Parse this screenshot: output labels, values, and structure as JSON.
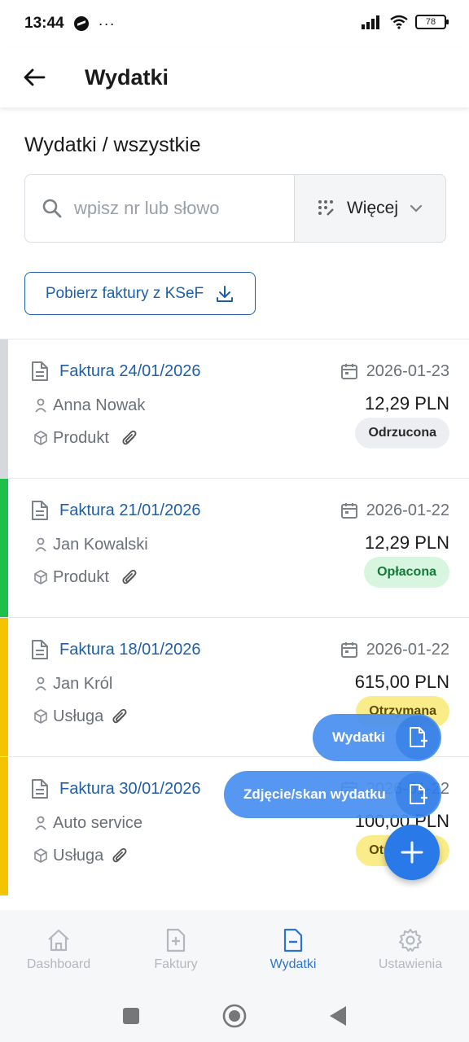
{
  "status_bar": {
    "time": "13:44",
    "battery": "78"
  },
  "header": {
    "title": "Wydatki"
  },
  "page": {
    "section_title": "Wydatki / wszystkie"
  },
  "search": {
    "placeholder": "wpisz nr lub słowo",
    "more_label": "Więcej"
  },
  "ksef_button": {
    "label": "Pobierz faktury z KSeF"
  },
  "invoices": [
    {
      "number": "Faktura 24/01/2026",
      "person": "Anna Nowak",
      "category": "Produkt",
      "date": "2026-01-23",
      "amount": "12,29 PLN",
      "status": "Odrzucona",
      "bar_color": "#d5d8dd"
    },
    {
      "number": "Faktura 21/01/2026",
      "person": "Jan Kowalski",
      "category": "Produkt",
      "date": "2026-01-22",
      "amount": "12,29 PLN",
      "status": "Opłacona",
      "bar_color": "#1fbf4c"
    },
    {
      "number": "Faktura 18/01/2026",
      "person": "Jan Król",
      "category": "Usługa",
      "date": "2026-01-22",
      "amount": "615,00 PLN",
      "status": "Otrzymana",
      "bar_color": "#f5c400"
    },
    {
      "number": "Faktura 30/01/2026",
      "person": "Auto service",
      "category": "Usługa",
      "date": "2026-01-22",
      "amount": "100,00 PLN",
      "status": "Otrzymana",
      "bar_color": "#f5c400"
    }
  ],
  "fab_menu": {
    "item_expense": "Wydatki",
    "item_photo": "Zdjęcie/skan wydatku"
  },
  "bottom_nav": {
    "dashboard": "Dashboard",
    "invoices": "Faktury",
    "expenses": "Wydatki",
    "settings": "Ustawienia"
  },
  "colors": {
    "accent": "#2f73d0",
    "link": "#1f5fa8"
  }
}
